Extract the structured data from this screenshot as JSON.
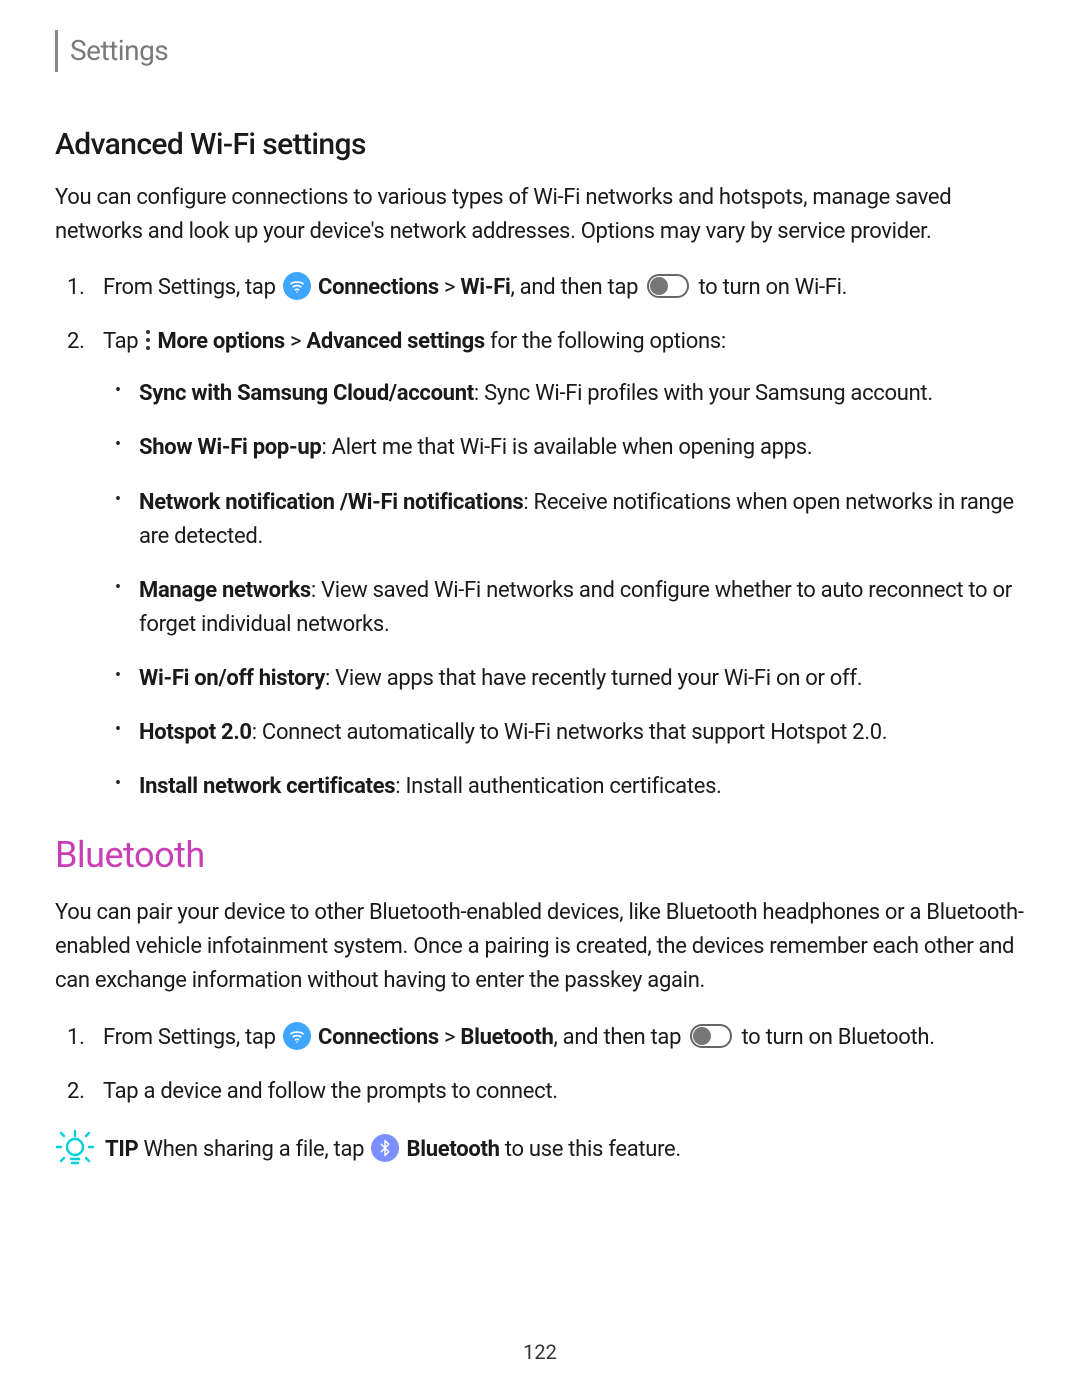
{
  "header": {
    "tab": "Settings"
  },
  "section1": {
    "title": "Advanced Wi-Fi settings",
    "intro": "You can configure connections to various types of Wi-Fi networks and hotspots, manage saved networks and look up your device's network addresses. Options may vary by service provider.",
    "step1_a": "From Settings, tap ",
    "step1_b": "Connections",
    "step1_c": " > ",
    "step1_d": "Wi-Fi",
    "step1_e": ", and then tap ",
    "step1_f": " to turn on Wi-Fi.",
    "step2_a": "Tap ",
    "step2_b": "More options",
    "step2_c": " > ",
    "step2_d": "Advanced settings",
    "step2_e": " for the following options:",
    "bullets": {
      "b1_bold": "Sync with Samsung Cloud/account",
      "b1_rest": ": Sync Wi-Fi profiles with your Samsung account.",
      "b2_bold": "Show Wi-Fi pop-up",
      "b2_rest": ": Alert me that Wi-Fi is available when opening apps.",
      "b3_bold": "Network notification /Wi-Fi notifications",
      "b3_rest": ": Receive notifications when open networks in range are detected.",
      "b4_bold": "Manage networks",
      "b4_rest": ": View saved Wi-Fi networks and configure whether to auto reconnect to or forget individual networks.",
      "b5_bold": "Wi-Fi on/off history",
      "b5_rest": ": View apps that have recently turned your Wi-Fi on or off.",
      "b6_bold": "Hotspot 2.0",
      "b6_rest": ": Connect automatically to Wi-Fi networks that support Hotspot 2.0.",
      "b7_bold": "Install network certificates",
      "b7_rest": ": Install authentication certificates."
    }
  },
  "section2": {
    "title": "Bluetooth",
    "intro": "You can pair your device to other Bluetooth-enabled devices, like Bluetooth headphones or a Bluetooth-enabled vehicle infotainment system. Once a pairing is created, the devices remember each other and can exchange information without having to enter the passkey again.",
    "step1_a": "From Settings, tap ",
    "step1_b": "Connections",
    "step1_c": " > ",
    "step1_d": "Bluetooth",
    "step1_e": ", and then tap ",
    "step1_f": " to turn on Bluetooth.",
    "step2": "Tap a device and follow the prompts to connect.",
    "tip_label": "TIP",
    "tip_a": "  When sharing a file, tap ",
    "tip_b": "Bluetooth",
    "tip_c": " to use this feature."
  },
  "page_number": "122"
}
